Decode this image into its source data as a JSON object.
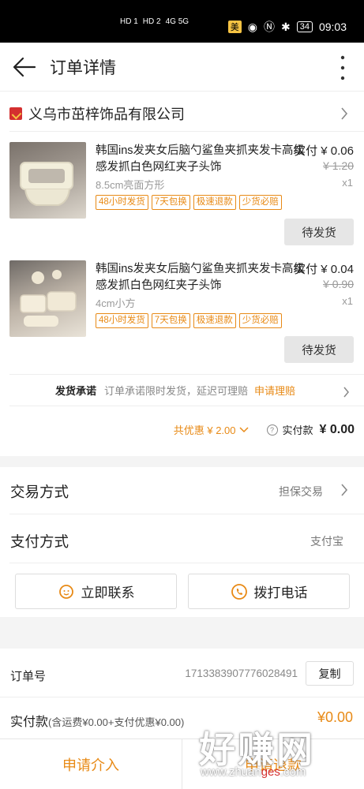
{
  "status_bar": {
    "hd1": "HD 1",
    "hd2": "HD 2",
    "net": "4G 5G",
    "badge": "美",
    "battery": "34",
    "time": "09:03"
  },
  "header": {
    "title": "订单详情"
  },
  "shop": {
    "name": "义乌市茁梓饰品有限公司"
  },
  "items": [
    {
      "title": "韩国ins发夹女后脑勺鲨鱼夹抓夹发卡高级感发抓白色网红夹子头饰",
      "price_label": "实付",
      "price": "¥ 0.06",
      "original_price": "¥ 1.20",
      "spec": "8.5cm亮面方形",
      "qty": "x1",
      "tags": [
        "48小时发货",
        "7天包换",
        "极速退款",
        "少货必赔"
      ],
      "status": "待发货"
    },
    {
      "title": "韩国ins发夹女后脑勺鲨鱼夹抓夹发卡高级感发抓白色网红夹子头饰",
      "price_label": "实付",
      "price": "¥ 0.04",
      "original_price": "¥ 0.90",
      "spec": "4cm小方",
      "qty": "x1",
      "tags": [
        "48小时发货",
        "7天包换",
        "极速退款",
        "少货必赔"
      ],
      "status": "待发货"
    }
  ],
  "promise": {
    "label": "发货承诺",
    "text": "订单承诺限时发货，延迟可理赔",
    "claim": "申请理赔"
  },
  "totals": {
    "discount": "共优惠 ¥ 2.00",
    "paid_label": "实付款",
    "paid_value": "¥ 0.00"
  },
  "trade": {
    "label": "交易方式",
    "value": "担保交易"
  },
  "payment": {
    "label": "支付方式",
    "value": "支付宝"
  },
  "contact": {
    "chat": "立即联系",
    "call": "拨打电话"
  },
  "order": {
    "label": "订单号",
    "number": "1713383907776028491",
    "copy": "复制",
    "paid_label": "实付款",
    "paid_note": "(含运费¥0.00+支付优惠¥0.00)",
    "paid_value": "¥0.00"
  },
  "bottom": {
    "intervene": "申请介入",
    "refund": "申请退款"
  },
  "watermark": {
    "main": "好赚网",
    "url_prefix": "www.zhuan",
    "url_mid": "ges",
    "url_suffix": ".com"
  },
  "colors": {
    "accent": "#e88a16",
    "brand_red": "#d42f2f"
  }
}
